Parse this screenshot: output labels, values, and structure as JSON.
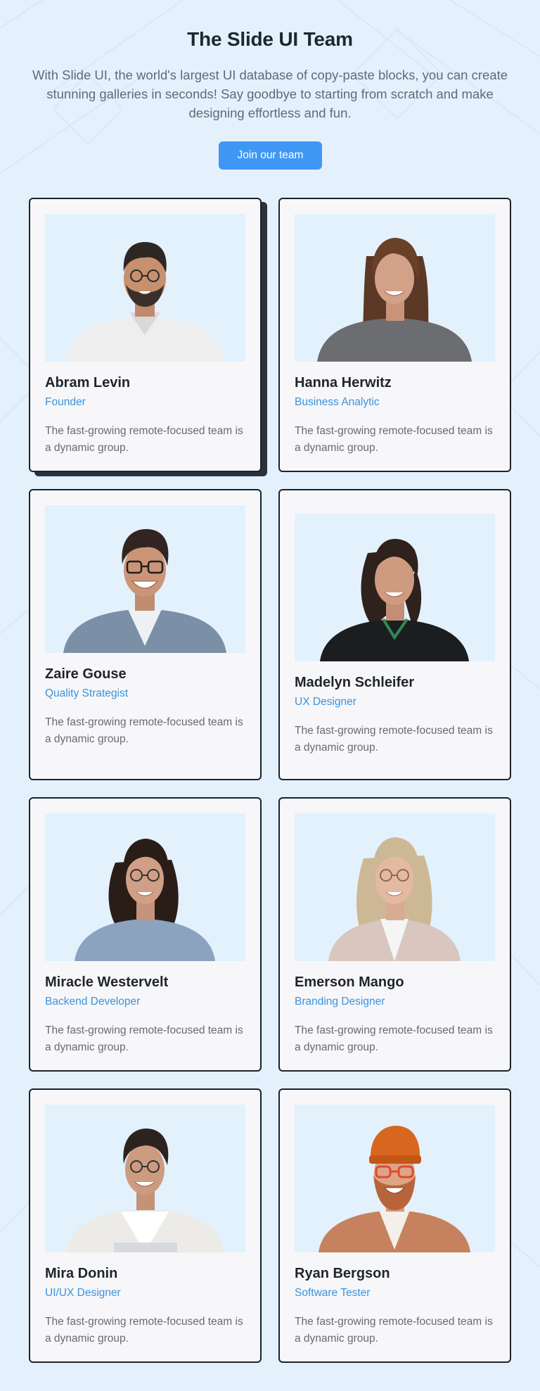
{
  "header": {
    "title": "The Slide UI Team",
    "subtitle": "With Slide UI, the world's largest UI database of copy-paste blocks, you can create stunning galleries in seconds! Say goodbye to starting from scratch and make designing effortless and fun.",
    "join_button_label": "Join our team"
  },
  "colors": {
    "background": "#e4f1fd",
    "accent": "#3f97f4",
    "role_text": "#3a92dc",
    "card_border": "#1b232c"
  },
  "team": [
    {
      "name": "Abram Levin",
      "role": "Founder",
      "description": "The fast-growing remote-focused team is a dynamic group."
    },
    {
      "name": "Hanna Herwitz",
      "role": "Business Analytic",
      "description": "The fast-growing remote-focused team is a dynamic group."
    },
    {
      "name": "Zaire Gouse",
      "role": "Quality Strategist",
      "description": "The fast-growing remote-focused team is a dynamic group."
    },
    {
      "name": "Madelyn Schleifer",
      "role": "UX Designer",
      "description": "The fast-growing remote-focused team is a dynamic group."
    },
    {
      "name": "Miracle Westervelt",
      "role": "Backend Developer",
      "description": "The fast-growing remote-focused team is a dynamic group."
    },
    {
      "name": "Emerson Mango",
      "role": "Branding Designer",
      "description": "The fast-growing remote-focused team is a dynamic group."
    },
    {
      "name": "Mira Donin",
      "role": "UI/UX Designer",
      "description": "The fast-growing remote-focused team is a dynamic group."
    },
    {
      "name": "Ryan Bergson",
      "role": "Software Tester",
      "description": "The fast-growing remote-focused team is a dynamic group."
    }
  ]
}
